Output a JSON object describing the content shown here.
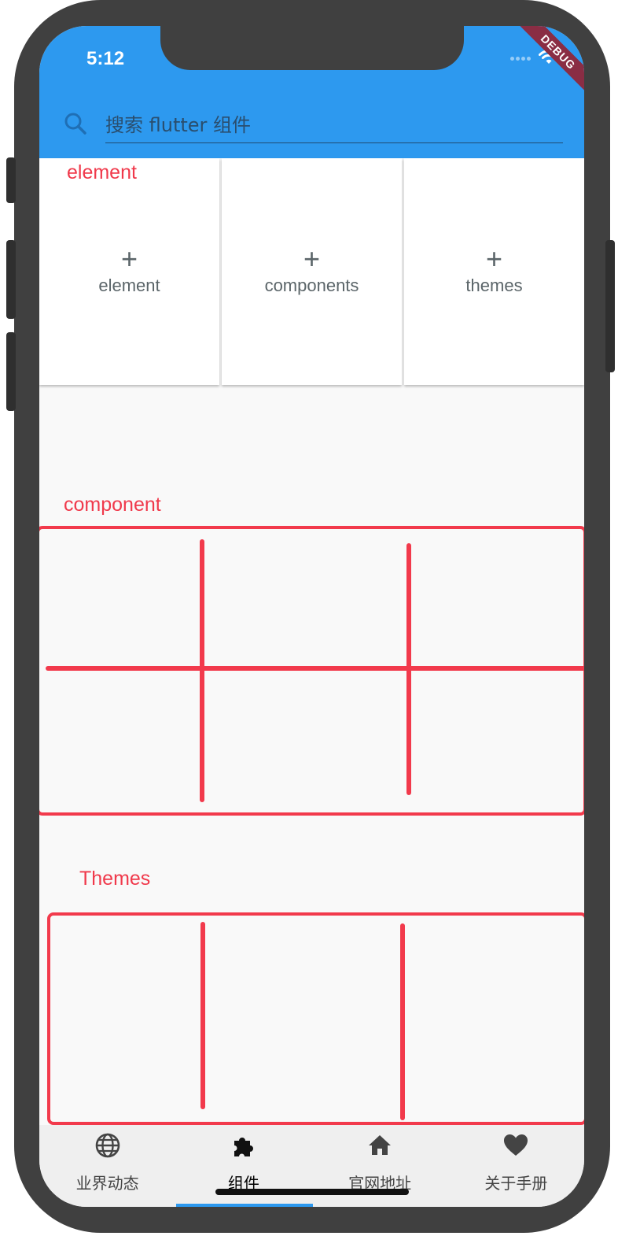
{
  "status_bar": {
    "time": "5:12",
    "debug_banner": "DEBUG"
  },
  "search": {
    "placeholder": "搜索 flutter 组件"
  },
  "element_section": {
    "title": "element",
    "cards": [
      {
        "label": "element",
        "icon": "plus-icon"
      },
      {
        "label": "components",
        "icon": "plus-icon"
      },
      {
        "label": "themes",
        "icon": "plus-icon"
      }
    ]
  },
  "component_section": {
    "title": "component"
  },
  "themes_section": {
    "title": "Themes"
  },
  "tabs": [
    {
      "label": "业界动态",
      "icon": "globe-icon"
    },
    {
      "label": "组件",
      "icon": "puzzle-icon"
    },
    {
      "label": "官网地址",
      "icon": "home-icon"
    },
    {
      "label": "关于手册",
      "icon": "heart-icon"
    }
  ],
  "colors": {
    "app_bar": "#2d99ef",
    "annotation": "#f23a4c",
    "active_tab_indicator": "#2d99ef"
  }
}
